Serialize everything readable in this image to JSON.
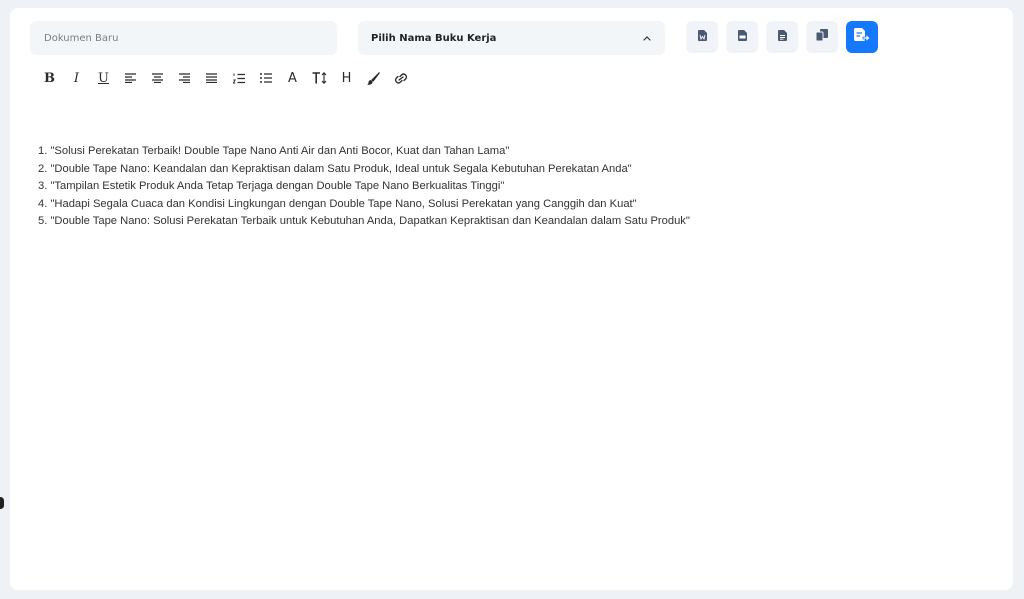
{
  "document": {
    "name_placeholder": "Dokumen Baru",
    "name_value": ""
  },
  "workbook_select": {
    "label": "Pilih Nama Buku Kerja"
  },
  "actions": {
    "icons": [
      "word-file-icon",
      "pdf-file-icon",
      "text-file-icon",
      "copy-icon",
      "save-export-icon"
    ],
    "primary_color": "#1479ff"
  },
  "toolbar": {
    "items": [
      "bold",
      "italic",
      "underline",
      "align-left",
      "align-center",
      "align-right",
      "align-justify",
      "ordered-list",
      "bullet-list",
      "font-color",
      "font-size",
      "heading",
      "highlight",
      "link"
    ],
    "bold_label": "B",
    "italic_label": "I",
    "underline_label": "U",
    "font_label": "A",
    "heading_label": "H"
  },
  "content": {
    "lines": [
      "1. \"Solusi Perekatan Terbaik! Double Tape Nano Anti Air dan Anti Bocor, Kuat dan Tahan Lama\"",
      "2. \"Double Tape Nano: Keandalan dan Kepraktisan dalam Satu Produk, Ideal untuk Segala Kebutuhan Perekatan Anda\"",
      "3. \"Tampilan Estetik Produk Anda Tetap Terjaga dengan Double Tape Nano Berkualitas Tinggi\"",
      "4. \"Hadapi Segala Cuaca dan Kondisi Lingkungan dengan Double Tape Nano, Solusi Perekatan yang Canggih dan Kuat\"",
      "5. \"Double Tape Nano: Solusi Perekatan Terbaik untuk Kebutuhan Anda, Dapatkan Kepraktisan dan Keandalan dalam Satu Produk\""
    ]
  }
}
